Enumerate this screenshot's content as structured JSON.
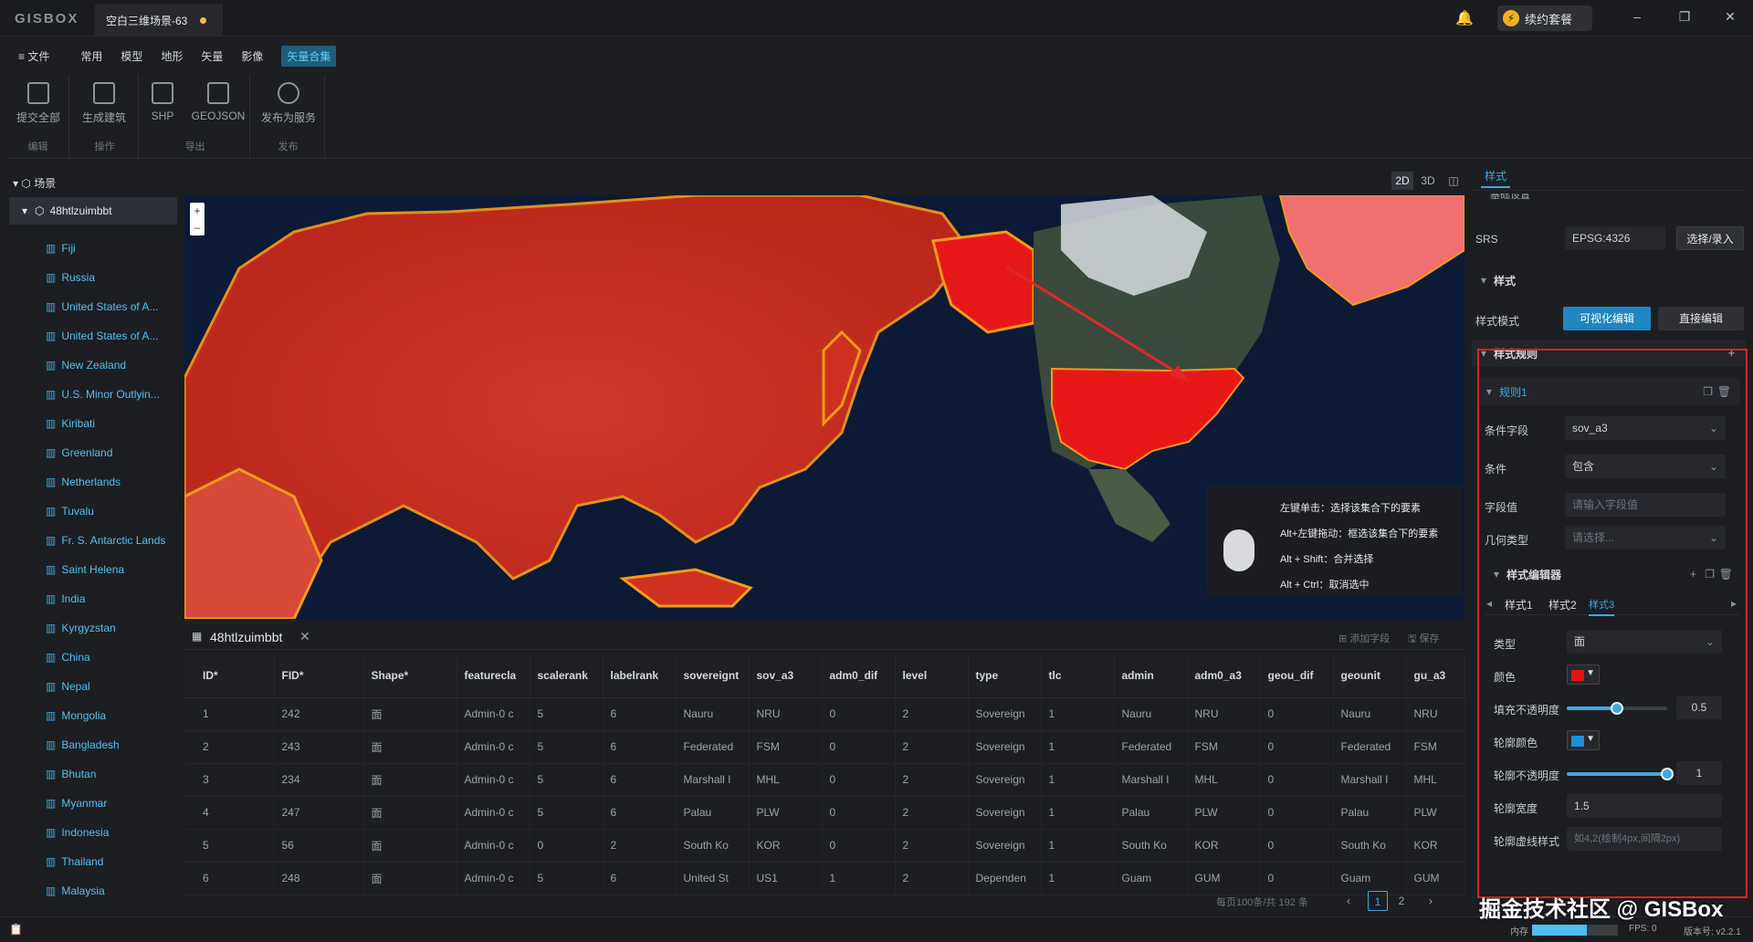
{
  "titlebar": {
    "logo": "GISBOX",
    "doc_tab": "空白三维场景-63",
    "renew_label": "续约套餐",
    "minimize": "–",
    "restore": "❐",
    "close": "✕"
  },
  "menu": {
    "file": "≡ 文件",
    "items": [
      "常用",
      "模型",
      "地形",
      "矢量",
      "影像",
      "矢量合集"
    ],
    "active": "矢量合集"
  },
  "toolbar": {
    "groups": [
      {
        "name": "编辑",
        "buttons": [
          "提交全部"
        ]
      },
      {
        "name": "操作",
        "buttons": [
          "生成建筑"
        ]
      },
      {
        "name": "导出",
        "buttons": [
          "SHP",
          "GEOJSON"
        ]
      },
      {
        "name": "发布",
        "buttons": [
          "发布为服务"
        ]
      }
    ]
  },
  "sidebar": {
    "scene_label": "场景",
    "root_layer": "48htlzuimbbt",
    "layers": [
      "Fiji",
      "Russia",
      "United States of A...",
      "United States of A...",
      "New Zealand",
      "U.S. Minor Outlyin...",
      "Kiribati",
      "Greenland",
      "Netherlands",
      "Tuvalu",
      "Fr. S. Antarctic Lands",
      "Saint Helena",
      "India",
      "Kyrgyzstan",
      "China",
      "Nepal",
      "Mongolia",
      "Bangladesh",
      "Bhutan",
      "Myanmar",
      "Indonesia",
      "Thailand",
      "Malaysia"
    ]
  },
  "view_tabs": [
    "2D",
    "3D",
    "◫"
  ],
  "map": {
    "zoom_in": "+",
    "zoom_out": "–",
    "tooltip": [
      "左键单击：选择该集合下的要素",
      "Alt+左键拖动：框选该集合下的要素",
      "Alt + Shift：合并选择",
      "Alt + Ctrl：取消选中"
    ]
  },
  "table": {
    "tab_name": "48htlzuimbbt",
    "add_field": "添加字段",
    "save": "保存",
    "columns": [
      "ID*",
      "FID*",
      "Shape*",
      "featurecla",
      "scalerank",
      "labelrank",
      "sovereignt",
      "sov_a3",
      "adm0_dif",
      "level",
      "type",
      "tlc",
      "admin",
      "adm0_a3",
      "geou_dif",
      "geounit",
      "gu_a3"
    ],
    "rows": [
      [
        "1",
        "242",
        "面",
        "Admin-0 c",
        "5",
        "6",
        "Nauru",
        "NRU",
        "0",
        "2",
        "Sovereign",
        "1",
        "Nauru",
        "NRU",
        "0",
        "Nauru",
        "NRU"
      ],
      [
        "2",
        "243",
        "面",
        "Admin-0 c",
        "5",
        "6",
        "Federated",
        "FSM",
        "0",
        "2",
        "Sovereign",
        "1",
        "Federated",
        "FSM",
        "0",
        "Federated",
        "FSM"
      ],
      [
        "3",
        "234",
        "面",
        "Admin-0 c",
        "5",
        "6",
        "Marshall I",
        "MHL",
        "0",
        "2",
        "Sovereign",
        "1",
        "Marshall I",
        "MHL",
        "0",
        "Marshall I",
        "MHL"
      ],
      [
        "4",
        "247",
        "面",
        "Admin-0 c",
        "5",
        "6",
        "Palau",
        "PLW",
        "0",
        "2",
        "Sovereign",
        "1",
        "Palau",
        "PLW",
        "0",
        "Palau",
        "PLW"
      ],
      [
        "5",
        "56",
        "面",
        "Admin-0 c",
        "0",
        "2",
        "South Ko",
        "KOR",
        "0",
        "2",
        "Sovereign",
        "1",
        "South Ko",
        "KOR",
        "0",
        "South Ko",
        "KOR"
      ],
      [
        "6",
        "248",
        "面",
        "Admin-0 c",
        "5",
        "6",
        "United St",
        "US1",
        "1",
        "2",
        "Dependen",
        "1",
        "Guam",
        "GUM",
        "0",
        "Guam",
        "GUM"
      ]
    ],
    "pager_info": "每页100条/共 192 条",
    "pages": [
      "1",
      "2"
    ],
    "prev": "‹",
    "next": "›"
  },
  "right_panel": {
    "tab": "样式",
    "basic_settings": "基础设置",
    "srs_label": "SRS",
    "srs_value": "EPSG:4326",
    "srs_button": "选择/录入",
    "style_section": "样式",
    "style_mode_label": "样式模式",
    "mode_visual": "可视化编辑",
    "mode_direct": "直接编辑",
    "rules_title": "样式规则",
    "rule1": "规则1",
    "cond_field_label": "条件字段",
    "cond_field_value": "sov_a3",
    "cond_label": "条件",
    "cond_value": "包含",
    "field_value_label": "字段值",
    "field_value_placeholder": "请输入字段值",
    "geom_label": "几何类型",
    "geom_placeholder": "请选择...",
    "editor_title": "样式编辑器",
    "style_tabs": [
      "样式1",
      "样式2",
      "样式3"
    ],
    "type_label": "类型",
    "type_value": "面",
    "color_label": "颜色",
    "color_value": "#e81010",
    "fill_opacity_label": "填充不透明度",
    "fill_opacity_value": "0.5",
    "stroke_color_label": "轮廓颜色",
    "stroke_color_value": "#1e8fd8",
    "stroke_opacity_label": "轮廓不透明度",
    "stroke_opacity_value": "1",
    "stroke_width_label": "轮廓宽度",
    "stroke_width_value": "1.5",
    "dash_label": "轮廓虚线样式",
    "dash_placeholder": "如4,2(绘制4px,间隔2px)"
  },
  "status": {
    "memory_label": "内存",
    "fps": "FPS: 0",
    "version": "版本号: v2.2.1"
  },
  "watermark": "掘金技术社区 @ GISBox",
  "colors": {
    "accent": "#3ea8e0",
    "highlight_fill": "#e81010",
    "map_ocean": "#0c1a35"
  }
}
